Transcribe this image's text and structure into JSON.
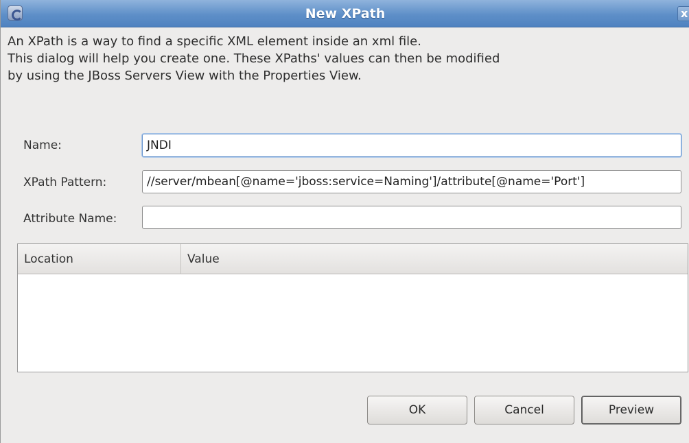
{
  "window": {
    "title": "New XPath",
    "close_glyph": "x"
  },
  "description": {
    "line1": "An XPath is a way to find a specific XML element inside an xml file.",
    "line2": "This dialog will help you create one. These XPaths' values can then be modified",
    "line3": "by using the JBoss Servers View with the Properties View."
  },
  "form": {
    "name": {
      "label": "Name:",
      "value": "JNDI"
    },
    "xpath_pattern": {
      "label": "XPath Pattern:",
      "value": "//server/mbean[@name='jboss:service=Naming']/attribute[@name='Port']"
    },
    "attribute_name": {
      "label": "Attribute Name:",
      "value": ""
    }
  },
  "table": {
    "columns": [
      "Location",
      "Value"
    ],
    "rows": []
  },
  "buttons": {
    "ok": "OK",
    "cancel": "Cancel",
    "preview": "Preview"
  },
  "icons": {
    "app": "eclipse-icon",
    "close": "close-icon"
  }
}
